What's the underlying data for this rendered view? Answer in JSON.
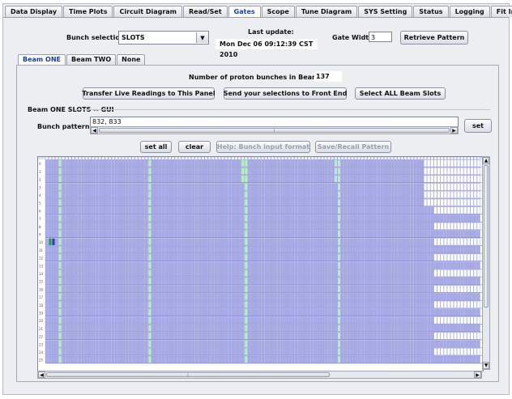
{
  "tabs": [
    {
      "label": "Data Display",
      "active": false
    },
    {
      "label": "Time Plots",
      "active": false
    },
    {
      "label": "Circuit Diagram",
      "active": false
    },
    {
      "label": "Read/Set",
      "active": false
    },
    {
      "label": "Gates",
      "active": true
    },
    {
      "label": "Scope",
      "active": false
    },
    {
      "label": "Tune Diagram",
      "active": false
    },
    {
      "label": "SYS Setting",
      "active": false
    },
    {
      "label": "Status",
      "active": false
    },
    {
      "label": "Logging",
      "active": false
    },
    {
      "label": "Fit Info",
      "active": false
    }
  ],
  "header": {
    "bunch_selection_label": "Bunch selection:",
    "bunch_selection_value": "SLOTS",
    "last_update_label": "Last update:",
    "last_update_value": "Mon Dec 06 09:12:39 CST 2010",
    "gate_width_label": "Gate Width:",
    "gate_width_value": "3",
    "retrieve_button": "Retrieve Pattern"
  },
  "beam_tabs": [
    {
      "label": "Beam ONE",
      "active": true
    },
    {
      "label": "Beam TWO",
      "active": false
    },
    {
      "label": "None",
      "active": false
    }
  ],
  "panel": {
    "num_bunches_label": "Number of proton bunches in Beam ONE:",
    "num_bunches_value": "137",
    "transfer_button": "Transfer Live Readings to This Panel",
    "send_button": "Send your selections to Front End",
    "select_all_button": "Select ALL Beam Slots",
    "group_title": "Beam ONE SLOTS -- GUI",
    "bunch_pattern_label": "Bunch pattern :",
    "bunch_pattern_value": "832, 833",
    "set_button": "set",
    "set_all_button": "set all",
    "clear_button": "clear",
    "help_button": "Help: Bunch input format",
    "save_recall_button": "Save/Recall Pattern"
  },
  "grid": {
    "rows": 26,
    "row_labels": [
      "0",
      "1",
      "2",
      "3",
      "4",
      "5",
      "6",
      "7",
      "8",
      "9",
      "10",
      "11",
      "12",
      "13",
      "14",
      "15",
      "16",
      "17",
      "18",
      "19",
      "20",
      "21",
      "22",
      "23",
      "24",
      "25"
    ],
    "colors": {
      "slot": "#a9abe6",
      "slot_border": "#8b8ed8",
      "empty": "#ffffff",
      "selected": "#2f9a4a",
      "active": "#2a44c8",
      "gap": "#b5efc4",
      "header": "#e2e4f4"
    }
  }
}
